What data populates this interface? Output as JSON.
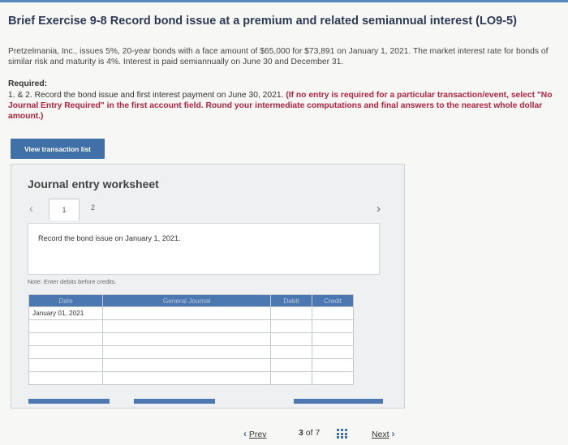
{
  "title": "Brief Exercise 9-8 Record bond issue at a premium and related semiannual interest (LO9-5)",
  "problem": "Pretzelmania, Inc., issues 5%, 20-year bonds with a face amount of $65,000 for $73,891 on January 1, 2021. The market interest rate for bonds of similar risk and maturity is 4%. Interest is paid semiannually on June 30 and December 31.",
  "required": {
    "heading": "Required:",
    "text": "1. & 2. Record the bond issue and first interest payment on June 30, 2021.",
    "instruction": "(If no entry is required for a particular transaction/event, select \"No Journal Entry Required\" in the first account field. Round your intermediate computations and final answers to the nearest whole dollar amount.)"
  },
  "view_button": "View transaction list",
  "worksheet": {
    "title": "Journal entry worksheet",
    "tabs": [
      "1",
      "2"
    ],
    "description": "Record the bond issue on January 1, 2021.",
    "note": "Note: Enter debits before credits.",
    "headers": [
      "Date",
      "General Journal",
      "Debit",
      "Credit"
    ],
    "rows": [
      [
        "January 01, 2021",
        "",
        "",
        ""
      ],
      [
        "",
        "",
        "",
        ""
      ],
      [
        "",
        "",
        "",
        ""
      ],
      [
        "",
        "",
        "",
        ""
      ],
      [
        "",
        "",
        "",
        ""
      ],
      [
        "",
        "",
        "",
        ""
      ]
    ]
  },
  "nav": {
    "prev": "Prev",
    "page_current": "3",
    "page_of": "of",
    "page_total": "7",
    "next": "Next"
  }
}
